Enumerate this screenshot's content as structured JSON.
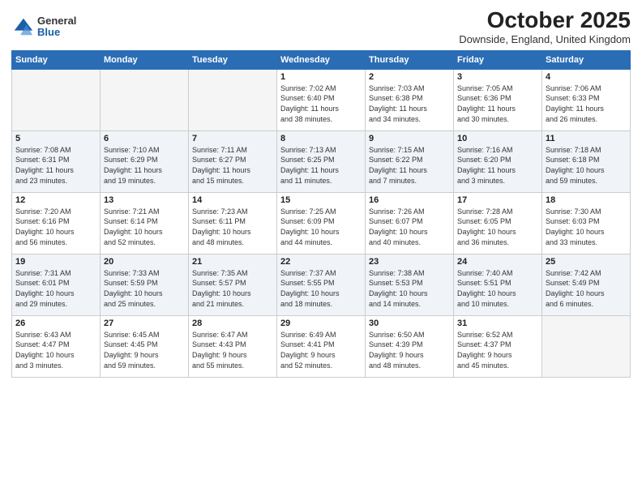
{
  "header": {
    "logo_general": "General",
    "logo_blue": "Blue",
    "month_title": "October 2025",
    "location": "Downside, England, United Kingdom"
  },
  "weekdays": [
    "Sunday",
    "Monday",
    "Tuesday",
    "Wednesday",
    "Thursday",
    "Friday",
    "Saturday"
  ],
  "weeks": [
    [
      {
        "day": "",
        "info": ""
      },
      {
        "day": "",
        "info": ""
      },
      {
        "day": "",
        "info": ""
      },
      {
        "day": "1",
        "info": "Sunrise: 7:02 AM\nSunset: 6:40 PM\nDaylight: 11 hours\nand 38 minutes."
      },
      {
        "day": "2",
        "info": "Sunrise: 7:03 AM\nSunset: 6:38 PM\nDaylight: 11 hours\nand 34 minutes."
      },
      {
        "day": "3",
        "info": "Sunrise: 7:05 AM\nSunset: 6:36 PM\nDaylight: 11 hours\nand 30 minutes."
      },
      {
        "day": "4",
        "info": "Sunrise: 7:06 AM\nSunset: 6:33 PM\nDaylight: 11 hours\nand 26 minutes."
      }
    ],
    [
      {
        "day": "5",
        "info": "Sunrise: 7:08 AM\nSunset: 6:31 PM\nDaylight: 11 hours\nand 23 minutes."
      },
      {
        "day": "6",
        "info": "Sunrise: 7:10 AM\nSunset: 6:29 PM\nDaylight: 11 hours\nand 19 minutes."
      },
      {
        "day": "7",
        "info": "Sunrise: 7:11 AM\nSunset: 6:27 PM\nDaylight: 11 hours\nand 15 minutes."
      },
      {
        "day": "8",
        "info": "Sunrise: 7:13 AM\nSunset: 6:25 PM\nDaylight: 11 hours\nand 11 minutes."
      },
      {
        "day": "9",
        "info": "Sunrise: 7:15 AM\nSunset: 6:22 PM\nDaylight: 11 hours\nand 7 minutes."
      },
      {
        "day": "10",
        "info": "Sunrise: 7:16 AM\nSunset: 6:20 PM\nDaylight: 11 hours\nand 3 minutes."
      },
      {
        "day": "11",
        "info": "Sunrise: 7:18 AM\nSunset: 6:18 PM\nDaylight: 10 hours\nand 59 minutes."
      }
    ],
    [
      {
        "day": "12",
        "info": "Sunrise: 7:20 AM\nSunset: 6:16 PM\nDaylight: 10 hours\nand 56 minutes."
      },
      {
        "day": "13",
        "info": "Sunrise: 7:21 AM\nSunset: 6:14 PM\nDaylight: 10 hours\nand 52 minutes."
      },
      {
        "day": "14",
        "info": "Sunrise: 7:23 AM\nSunset: 6:11 PM\nDaylight: 10 hours\nand 48 minutes."
      },
      {
        "day": "15",
        "info": "Sunrise: 7:25 AM\nSunset: 6:09 PM\nDaylight: 10 hours\nand 44 minutes."
      },
      {
        "day": "16",
        "info": "Sunrise: 7:26 AM\nSunset: 6:07 PM\nDaylight: 10 hours\nand 40 minutes."
      },
      {
        "day": "17",
        "info": "Sunrise: 7:28 AM\nSunset: 6:05 PM\nDaylight: 10 hours\nand 36 minutes."
      },
      {
        "day": "18",
        "info": "Sunrise: 7:30 AM\nSunset: 6:03 PM\nDaylight: 10 hours\nand 33 minutes."
      }
    ],
    [
      {
        "day": "19",
        "info": "Sunrise: 7:31 AM\nSunset: 6:01 PM\nDaylight: 10 hours\nand 29 minutes."
      },
      {
        "day": "20",
        "info": "Sunrise: 7:33 AM\nSunset: 5:59 PM\nDaylight: 10 hours\nand 25 minutes."
      },
      {
        "day": "21",
        "info": "Sunrise: 7:35 AM\nSunset: 5:57 PM\nDaylight: 10 hours\nand 21 minutes."
      },
      {
        "day": "22",
        "info": "Sunrise: 7:37 AM\nSunset: 5:55 PM\nDaylight: 10 hours\nand 18 minutes."
      },
      {
        "day": "23",
        "info": "Sunrise: 7:38 AM\nSunset: 5:53 PM\nDaylight: 10 hours\nand 14 minutes."
      },
      {
        "day": "24",
        "info": "Sunrise: 7:40 AM\nSunset: 5:51 PM\nDaylight: 10 hours\nand 10 minutes."
      },
      {
        "day": "25",
        "info": "Sunrise: 7:42 AM\nSunset: 5:49 PM\nDaylight: 10 hours\nand 6 minutes."
      }
    ],
    [
      {
        "day": "26",
        "info": "Sunrise: 6:43 AM\nSunset: 4:47 PM\nDaylight: 10 hours\nand 3 minutes."
      },
      {
        "day": "27",
        "info": "Sunrise: 6:45 AM\nSunset: 4:45 PM\nDaylight: 9 hours\nand 59 minutes."
      },
      {
        "day": "28",
        "info": "Sunrise: 6:47 AM\nSunset: 4:43 PM\nDaylight: 9 hours\nand 55 minutes."
      },
      {
        "day": "29",
        "info": "Sunrise: 6:49 AM\nSunset: 4:41 PM\nDaylight: 9 hours\nand 52 minutes."
      },
      {
        "day": "30",
        "info": "Sunrise: 6:50 AM\nSunset: 4:39 PM\nDaylight: 9 hours\nand 48 minutes."
      },
      {
        "day": "31",
        "info": "Sunrise: 6:52 AM\nSunset: 4:37 PM\nDaylight: 9 hours\nand 45 minutes."
      },
      {
        "day": "",
        "info": ""
      }
    ]
  ]
}
